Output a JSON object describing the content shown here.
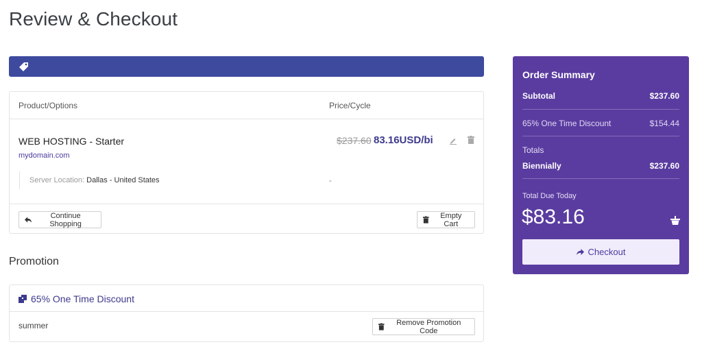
{
  "page": {
    "title": "Review & Checkout"
  },
  "cart": {
    "columns": {
      "product": "Product/Options",
      "price": "Price/Cycle"
    },
    "item": {
      "name": "WEB HOSTING - Starter",
      "domain": "mydomain.com",
      "price_old": "$237.60",
      "price_new": "83.16USD/bi",
      "option_label": "Server Location:",
      "option_value": "Dallas - United States",
      "option_price": "-"
    },
    "continue_label": "Continue Shopping",
    "empty_label": "Empty Cart"
  },
  "promotion": {
    "title": "Promotion",
    "discount_name": "65% One Time Discount",
    "code": "summer",
    "remove_label": "Remove Promotion Code"
  },
  "summary": {
    "title": "Order Summary",
    "subtotal_label": "Subtotal",
    "subtotal_value": "$237.60",
    "discount_label": "65% One Time Discount",
    "discount_value": "$154.44",
    "totals_label": "Totals",
    "cycle_label": "Biennially",
    "cycle_value": "$237.60",
    "due_label": "Total Due Today",
    "due_amount": "$83.16",
    "checkout_label": "Checkout"
  },
  "icons": {
    "promo_bar": "tag-icon",
    "edit": "pencil-icon",
    "remove": "trash-icon",
    "continue": "reply-arrow-icon",
    "discount": "ticket-icon",
    "basket": "basket-icon",
    "checkout": "arrow-right-icon"
  },
  "colors": {
    "brand_bar": "#3d4a9e",
    "summary_bg": "#5a3ca0",
    "accent_text": "#3d3a8c"
  }
}
